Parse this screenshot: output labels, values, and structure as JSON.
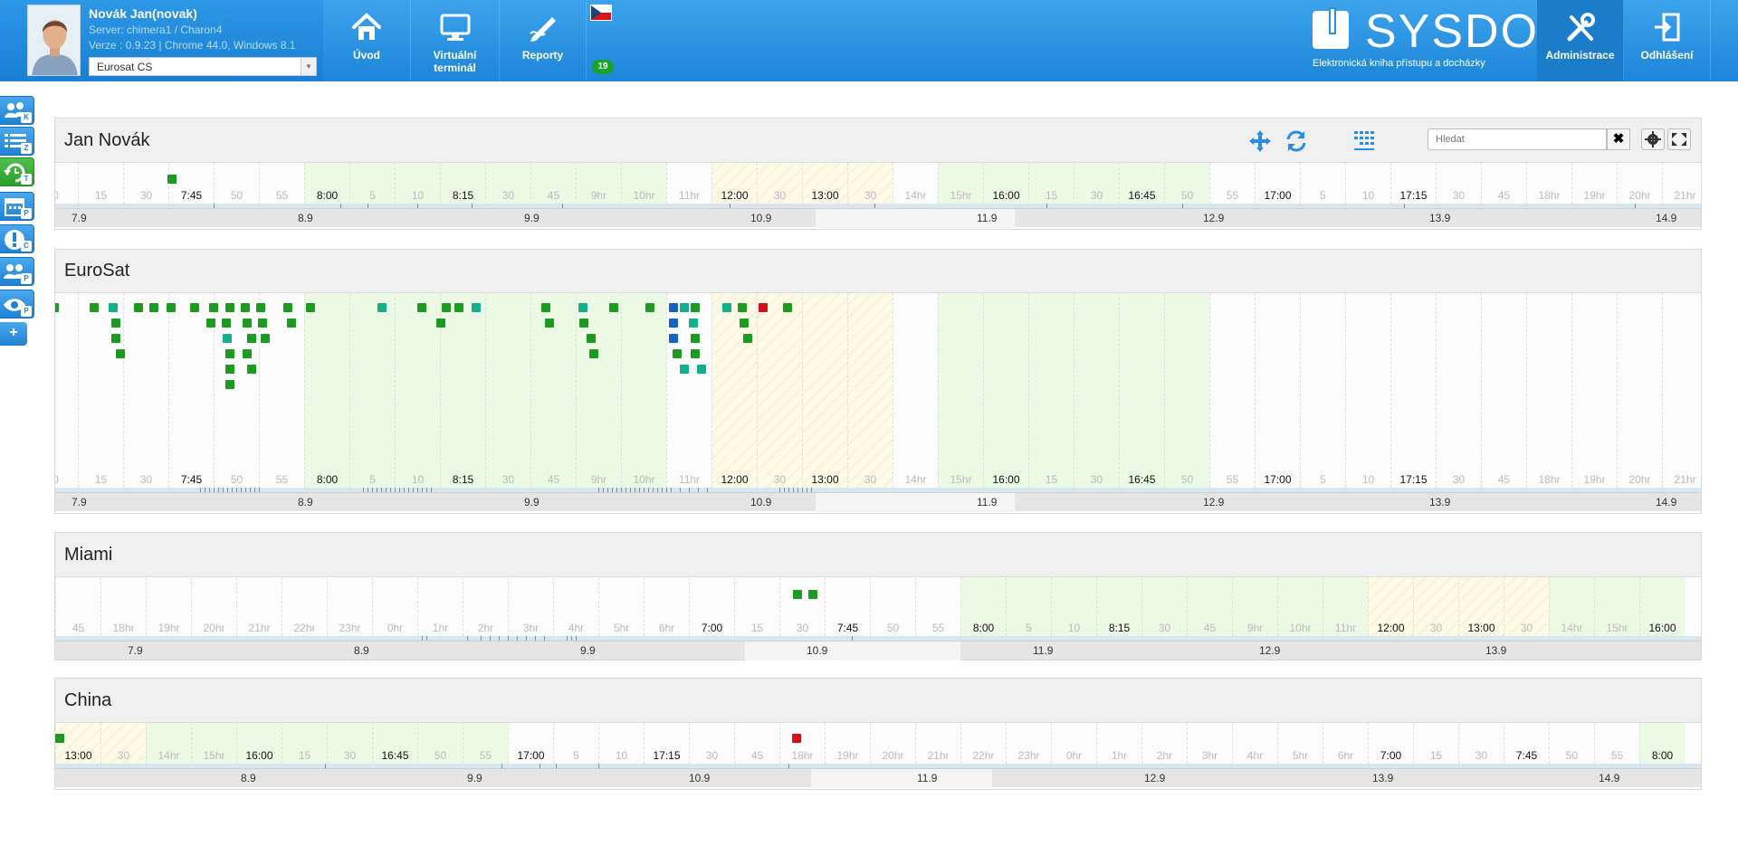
{
  "header": {
    "user_name": "Novák Jan(novak)",
    "server": "Server: chimera1 / Charon4",
    "version": "Verze : 0.9.23 | Chrome 44.0, Windows 8.1",
    "company": "Eurosat CS",
    "nav": [
      {
        "label": "Úvod",
        "icon": "home-icon"
      },
      {
        "label": "Virtuální terminál",
        "icon": "monitor-icon"
      },
      {
        "label": "Reporty",
        "icon": "pen-report-icon"
      }
    ],
    "language_flag": "czech-flag",
    "notification_count": "19",
    "brand": "SYSDO",
    "brand_subtitle": "Elektronická kniha přístupu a docházky",
    "admin_label": "Administrace",
    "logout_label": "Odhlášení"
  },
  "sidebar": {
    "buttons": [
      {
        "icon": "people-icon",
        "badge": "K"
      },
      {
        "icon": "list-icon",
        "badge": "Z"
      },
      {
        "icon": "refresh-clock-icon",
        "badge": "T"
      },
      {
        "icon": "calendar-icon",
        "badge": "P"
      },
      {
        "icon": "alert-icon",
        "badge": "C"
      },
      {
        "icon": "group-icon",
        "badge": "P"
      },
      {
        "icon": "eye-icon",
        "badge": "P"
      }
    ],
    "add_label": "+"
  },
  "toolbar": {
    "search_placeholder": "Hledat",
    "clear_label": "✖"
  },
  "colors": {
    "accent": "#1d86d8",
    "work": "#ecf9e4",
    "break": "#fdfae8",
    "dot_green": "#1d9a20",
    "dot_teal": "#13b08c",
    "dot_blue": "#1264be",
    "dot_red": "#d3101b"
  },
  "panels": [
    {
      "title": "Jan Novák",
      "labels": [
        "0",
        "15",
        "30",
        "7:45",
        "50",
        "55",
        "8:00",
        "5",
        "10",
        "8:15",
        "30",
        "45",
        "9hr",
        "10hr",
        "11hr",
        "12:00",
        "30",
        "13:00",
        "30",
        "14hr",
        "15hr",
        "16:00",
        "15",
        "30",
        "16:45",
        "50",
        "55",
        "17:00",
        "5",
        "10",
        "17:15",
        "30",
        "45",
        "18hr",
        "19hr",
        "20hr",
        "21hr"
      ],
      "dates": [
        "7.9",
        "8.9",
        "9.9",
        "10.9",
        "11.9",
        "12.9",
        "13.9",
        "14.9"
      ]
    },
    {
      "title": "EuroSat",
      "labels": [
        "0",
        "15",
        "30",
        "7:45",
        "50",
        "55",
        "8:00",
        "5",
        "10",
        "8:15",
        "30",
        "45",
        "9hr",
        "10hr",
        "11hr",
        "12:00",
        "30",
        "13:00",
        "30",
        "14hr",
        "15hr",
        "16:00",
        "15",
        "30",
        "16:45",
        "50",
        "55",
        "17:00",
        "5",
        "10",
        "17:15",
        "30",
        "45",
        "18hr",
        "19hr",
        "20hr",
        "21hr"
      ],
      "dates": [
        "7.9",
        "8.9",
        "9.9",
        "10.9",
        "11.9",
        "12.9",
        "13.9",
        "14.9"
      ]
    },
    {
      "title": "Miami",
      "labels": [
        "45",
        "18hr",
        "19hr",
        "20hr",
        "21hr",
        "22hr",
        "23hr",
        "0hr",
        "1hr",
        "2hr",
        "3hr",
        "4hr",
        "5hr",
        "6hr",
        "7:00",
        "15",
        "30",
        "7:45",
        "50",
        "55",
        "8:00",
        "5",
        "10",
        "8:15",
        "30",
        "45",
        "9hr",
        "10hr",
        "11hr",
        "12:00",
        "30",
        "13:00",
        "30",
        "14hr",
        "15hr",
        "16:00"
      ],
      "dates": [
        "7.9",
        "8.9",
        "9.9",
        "10.9",
        "11.9",
        "12.9",
        "13.9"
      ]
    },
    {
      "title": "China",
      "labels": [
        "13:00",
        "30",
        "14hr",
        "15hr",
        "16:00",
        "15",
        "30",
        "16:45",
        "50",
        "55",
        "17:00",
        "5",
        "10",
        "17:15",
        "30",
        "45",
        "18hr",
        "19hr",
        "20hr",
        "21hr",
        "22hr",
        "23hr",
        "0hr",
        "1hr",
        "2hr",
        "3hr",
        "4hr",
        "5hr",
        "6hr",
        "7:00",
        "15",
        "30",
        "7:45",
        "50",
        "55",
        "8:00"
      ],
      "dates": [
        "8.9",
        "9.9",
        "10.9",
        "11.9",
        "12.9",
        "13.9",
        "14.9"
      ]
    }
  ]
}
